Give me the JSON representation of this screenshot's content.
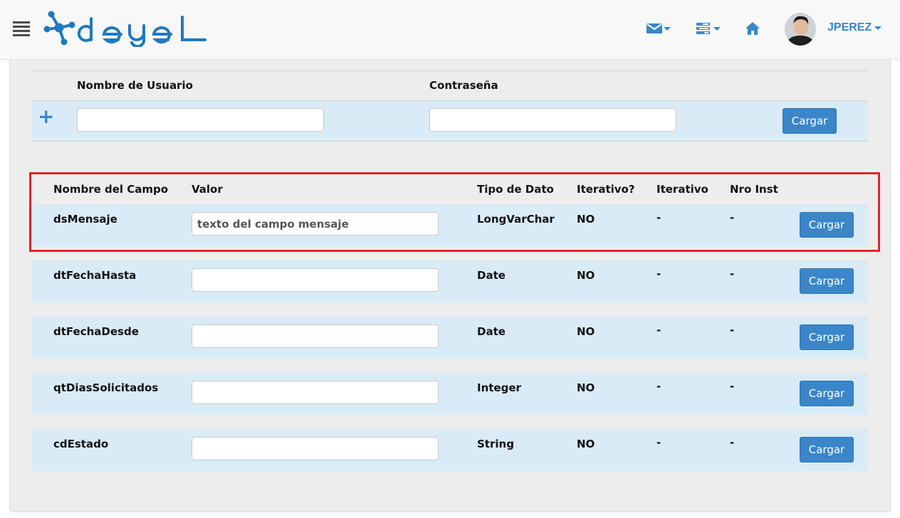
{
  "navbar": {
    "logo_text": "deyel",
    "icons": [
      "menu-icon",
      "envelope-icon",
      "tasks-icon",
      "home-icon"
    ],
    "user_name": "JPEREZ",
    "accent_color": "#3a86c8"
  },
  "login_form": {
    "username_label": "Nombre de Usuario",
    "password_label": "Contraseña",
    "username_value": "",
    "password_value": "",
    "load_button": "Cargar"
  },
  "fields_table": {
    "headers": {
      "field_name": "Nombre del Campo",
      "value": "Valor",
      "data_type": "Tipo de Dato",
      "is_iterative": "Iterativo?",
      "iterative": "Iterativo",
      "instance_no": "Nro Inst"
    },
    "rows": [
      {
        "name": "dsMensaje",
        "value": "texto del campo mensaje",
        "type": "LongVarChar",
        "is_iterative": "NO",
        "iterative": "-",
        "instance": "-",
        "button": "Cargar"
      },
      {
        "name": "dtFechaHasta",
        "value": "",
        "type": "Date",
        "is_iterative": "NO",
        "iterative": "-",
        "instance": "-",
        "button": "Cargar"
      },
      {
        "name": "dtFechaDesde",
        "value": "",
        "type": "Date",
        "is_iterative": "NO",
        "iterative": "-",
        "instance": "-",
        "button": "Cargar"
      },
      {
        "name": "qtDiasSolicitados",
        "value": "",
        "type": "Integer",
        "is_iterative": "NO",
        "iterative": "-",
        "instance": "-",
        "button": "Cargar"
      },
      {
        "name": "cdEstado",
        "value": "",
        "type": "String",
        "is_iterative": "NO",
        "iterative": "-",
        "instance": "-",
        "button": "Cargar"
      }
    ],
    "highlight_color": "#e0242c"
  }
}
